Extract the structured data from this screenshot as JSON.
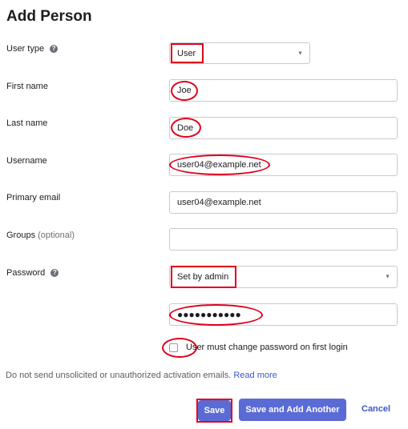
{
  "page": {
    "title": "Add Person"
  },
  "form": {
    "user_type": {
      "label": "User type",
      "help": "?",
      "value": "User"
    },
    "first_name": {
      "label": "First name",
      "value": "Joe"
    },
    "last_name": {
      "label": "Last name",
      "value": "Doe"
    },
    "username": {
      "label": "Username",
      "value": "user04@example.net"
    },
    "primary_email": {
      "label": "Primary email",
      "value": "user04@example.net"
    },
    "groups": {
      "label": "Groups",
      "optional": "(optional)",
      "value": ""
    },
    "password": {
      "label": "Password",
      "help": "?",
      "value": "Set by admin",
      "masked_value": "●●●●●●●●●●●"
    },
    "change_password": {
      "label": "User must change password on first login",
      "checked": false
    }
  },
  "notice": {
    "text": "Do not send unsolicited or unauthorized activation emails.",
    "link": "Read more"
  },
  "buttons": {
    "save": "Save",
    "save_another": "Save and Add Another",
    "cancel": "Cancel"
  },
  "colors": {
    "primary_button": "#5b6bd6",
    "link": "#3a58c8",
    "annotation": "#e0001a"
  }
}
